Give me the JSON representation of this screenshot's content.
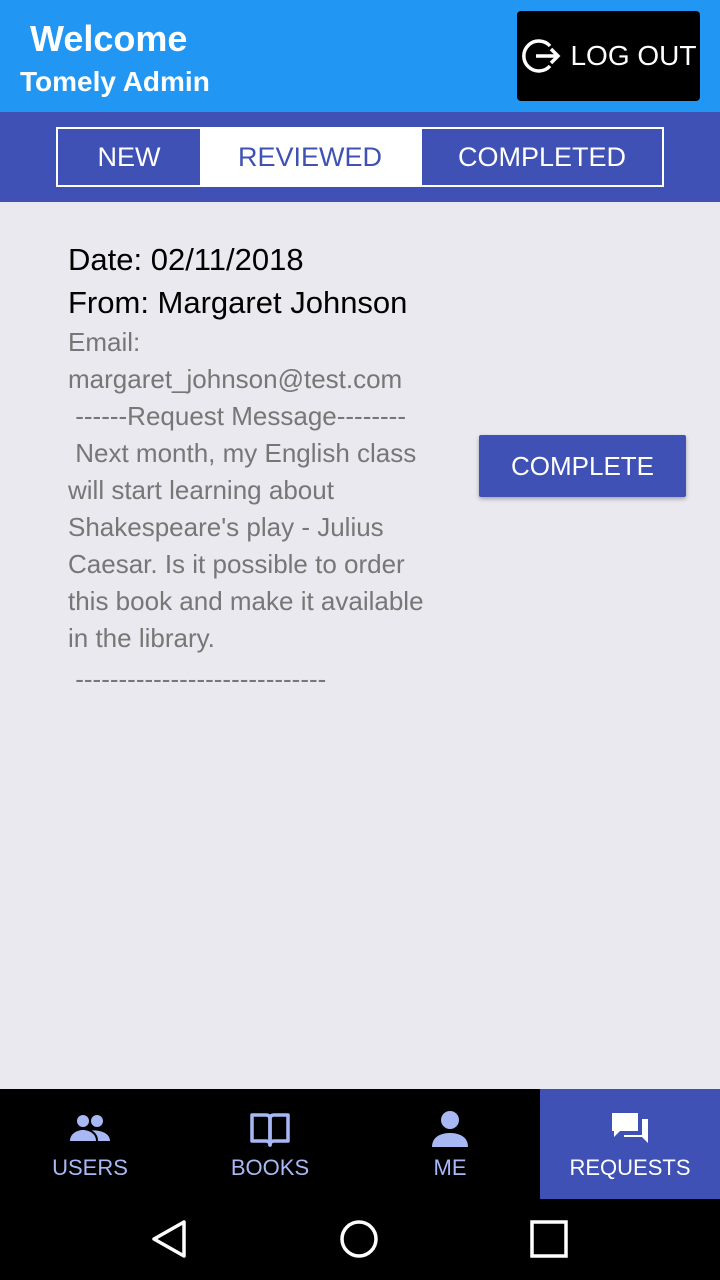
{
  "header": {
    "title": "Welcome",
    "subtitle": "Tomely Admin",
    "logout_label": "LOG OUT"
  },
  "tabs": [
    {
      "label": "NEW"
    },
    {
      "label": "REVIEWED"
    },
    {
      "label": "COMPLETED"
    }
  ],
  "active_tab": "REVIEWED",
  "request": {
    "date": "Date: 02/11/2018",
    "from": "From: Margaret Johnson",
    "email_label": "Email:",
    "email": "margaret_johnson@test.com",
    "separator_top": " ------Request Message--------",
    "message": " Next month, my English class will start learning about Shakespeare's play - Julius Caesar. Is it possible to order this book and make it available in the library.",
    "separator_bottom": " -----------------------------",
    "action_label": "COMPLETE"
  },
  "bottom_nav": [
    {
      "label": "USERS",
      "icon": "users-icon"
    },
    {
      "label": "BOOKS",
      "icon": "book-icon"
    },
    {
      "label": "ME",
      "icon": "person-icon"
    },
    {
      "label": "REQUESTS",
      "icon": "chat-icon"
    }
  ],
  "active_nav": "REQUESTS",
  "colors": {
    "header": "#2196f3",
    "primary": "#3f51b5",
    "background": "#e9e9ef",
    "nav_inactive": "#a8b8f4"
  }
}
